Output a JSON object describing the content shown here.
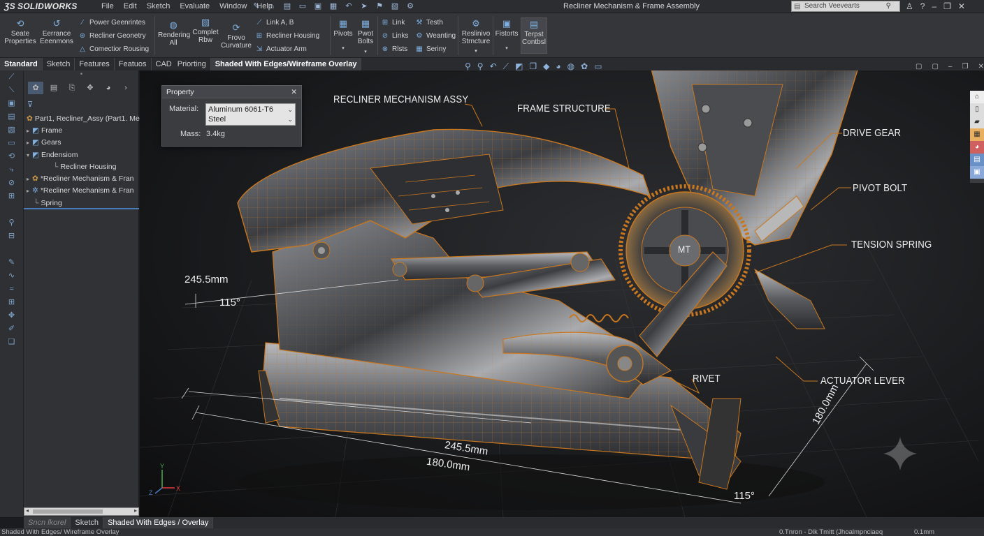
{
  "app": {
    "brand": "SOLIDWORKS",
    "window_title": "Recliner Mechanism & Frame Assembly"
  },
  "menu": [
    "File",
    "Edit",
    "Sketch",
    "Evaluate",
    "Window",
    "Help"
  ],
  "search": {
    "placeholder": "Search Veevearts"
  },
  "ribbon": {
    "big1": "Seate Properties",
    "big2": "Eerrance Eeenmons",
    "small_a": [
      "Power Geenrintes",
      "Recliner Geonetry",
      "Comectior Rousing"
    ],
    "big3": "Rendering All",
    "big4": "Complet Rbw",
    "big5": "Frovo Curvature",
    "small_b": [
      "Link A, B",
      "Recliner Housing",
      "Actuator Arm"
    ],
    "big6": "Pivots",
    "big7": "Pwot Bolts",
    "small_c": [
      "Link",
      "Links",
      "Rlsts"
    ],
    "small_d": [
      "Testh",
      "Weanting",
      "Seriny"
    ],
    "big8": "Reslinivo Strncture",
    "big9": "Fistorts",
    "big10": "Terpst Contbsl"
  },
  "tabs": [
    "Standard",
    "Sketch",
    "Features",
    "Featuos",
    "CAD",
    "Priorting",
    "Shaded With Edges/Wireframe Overlay"
  ],
  "tree": {
    "root": "Part1, Recliner_Assy (Part1. Mecr",
    "items": [
      "Frame",
      "Gears",
      "Endensiom",
      "Recliner Housing",
      "*Recliner Mechanism & Fran",
      "*Recliner Mechanism & Fran",
      "Spring"
    ]
  },
  "property": {
    "title": "Property",
    "material_label": "Material:",
    "material_value_1": "Aluminum 6061-T6",
    "material_value_2": "Steel",
    "mass_label": "Mass:",
    "mass_value": "3.4kg"
  },
  "callouts": {
    "assy": "RECLINER MECHANISM ASSY",
    "frame": "FRAME STRUCTURE",
    "drive": "DRIVE GEAR",
    "pivot": "PIVOT BOLT",
    "spring": "TENSION SPRING",
    "rivet": "RIVET",
    "lever": "ACTUATOR LEVER",
    "hub": "MT"
  },
  "dims": {
    "d1": "245.5mm",
    "d2": "115°",
    "d3": "245.5mm",
    "d4": "180.0mm",
    "d5": "180.0mm",
    "d6": "115°"
  },
  "bottom_tabs": [
    "Sncn lkorel",
    "Sketch",
    "Shaded With Edges / Overlay"
  ],
  "status": {
    "left": "Shaded With Edges/ Wireframe Overlay",
    "center": "0.Tnron - Dlk Tmitt (Jhoalmpnciaeq",
    "right": "0.1mm"
  },
  "colors": {
    "accent": "#d8832a",
    "wire": "#c9771f",
    "panel": "#303236"
  }
}
